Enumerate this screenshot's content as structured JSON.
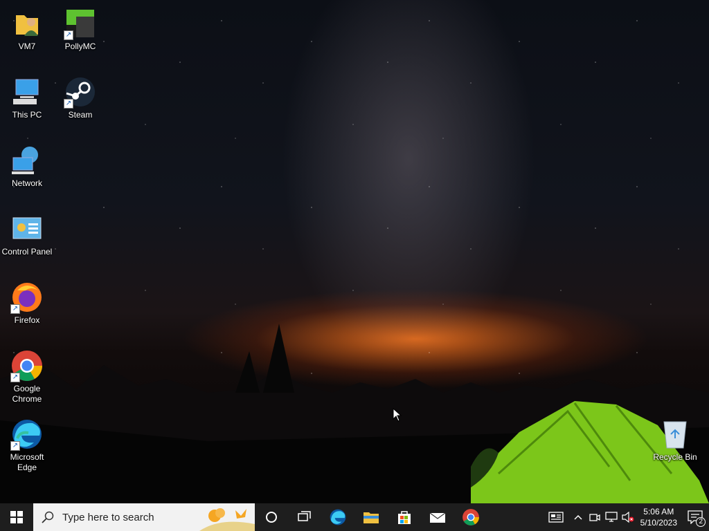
{
  "desktop": {
    "icons": [
      {
        "label": "VM7",
        "icon": "user-folder-icon"
      },
      {
        "label": "PollyMC",
        "icon": "pollymc-icon"
      },
      {
        "label": "This PC",
        "icon": "this-pc-icon"
      },
      {
        "label": "Steam",
        "icon": "steam-icon"
      },
      {
        "label": "Network",
        "icon": "network-icon"
      },
      {
        "label": "Control Panel",
        "icon": "control-panel-icon"
      },
      {
        "label": "Firefox",
        "icon": "firefox-icon"
      },
      {
        "label": "Google Chrome",
        "icon": "chrome-icon"
      },
      {
        "label": "Microsoft Edge",
        "icon": "edge-icon"
      },
      {
        "label": "Recycle Bin",
        "icon": "recycle-bin-icon"
      }
    ]
  },
  "taskbar": {
    "search_placeholder": "Type here to search",
    "pinned": [
      "cortana-icon",
      "task-view-icon",
      "edge-icon",
      "file-explorer-icon",
      "microsoft-store-icon",
      "mail-icon",
      "chrome-icon"
    ],
    "clock": {
      "time": "5:06 AM",
      "date": "5/10/2023"
    },
    "notifications_count": "2"
  },
  "colors": {
    "taskbar": "#1e1e1e",
    "accent": "#0078d7"
  }
}
